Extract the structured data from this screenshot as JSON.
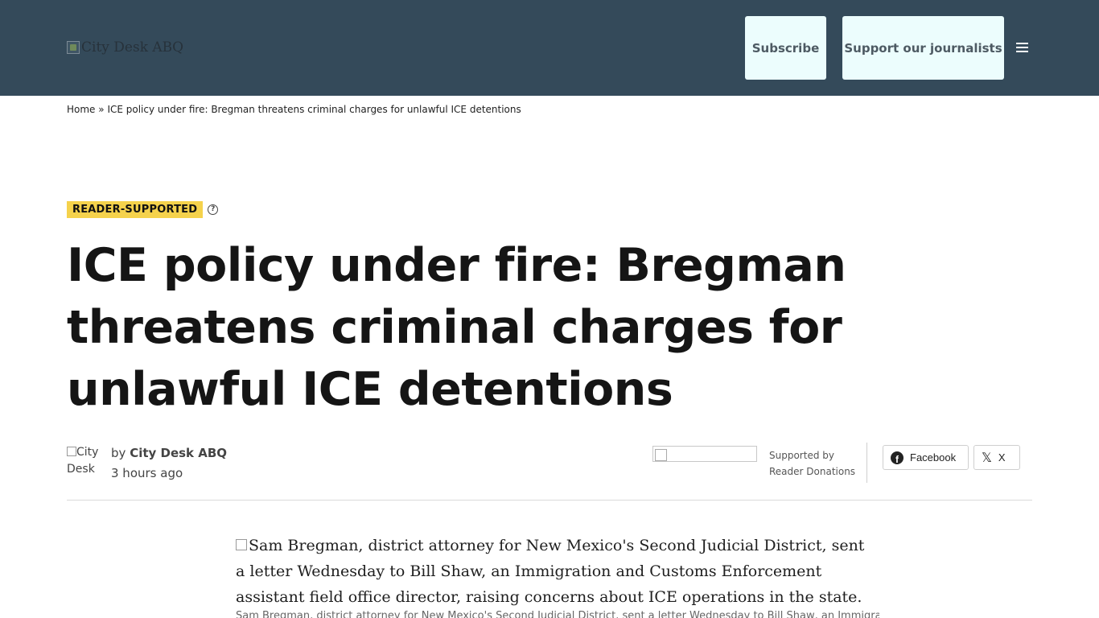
{
  "header": {
    "logo_alt": "City Desk ABQ",
    "subscribe_label": "Subscribe",
    "support_label": "Support our journalists",
    "menu_icon": "hamburger-icon"
  },
  "breadcrumb": {
    "home": "Home",
    "separator": "»",
    "current": "ICE policy under fire: Bregman threatens criminal charges for unlawful ICE detentions"
  },
  "badge": {
    "label": "READER-SUPPORTED",
    "help_icon": "question-circle-icon"
  },
  "title": "ICE policy under fire: Bregman threatens criminal charges for unlawful ICE detentions",
  "byline": {
    "avatar_alt": "City Desk",
    "by_prefix": "by",
    "author": "City Desk ABQ",
    "time": "3 hours ago"
  },
  "sponsor": {
    "line1": "Supported by",
    "line2": "Reader Donations"
  },
  "share": {
    "facebook_label": "Facebook",
    "x_label": "X"
  },
  "article": {
    "image_alt": "Sam Bregman, district attorney for New Mexico's Second Judicial District, sent a letter Wednesday to Bill Shaw, an Immigration and Customs Enforcement assistant field office director, raising concerns about ICE operations in the state.",
    "caption": "Sam Bregman, district attorney for New Mexico's Second Judicial District, sent a letter Wednesday to Bill Shaw, an Immigration"
  },
  "colors": {
    "header_bg": "#344a5a",
    "button_bg": "#ecfdfd",
    "badge_bg": "#f5d24c"
  }
}
